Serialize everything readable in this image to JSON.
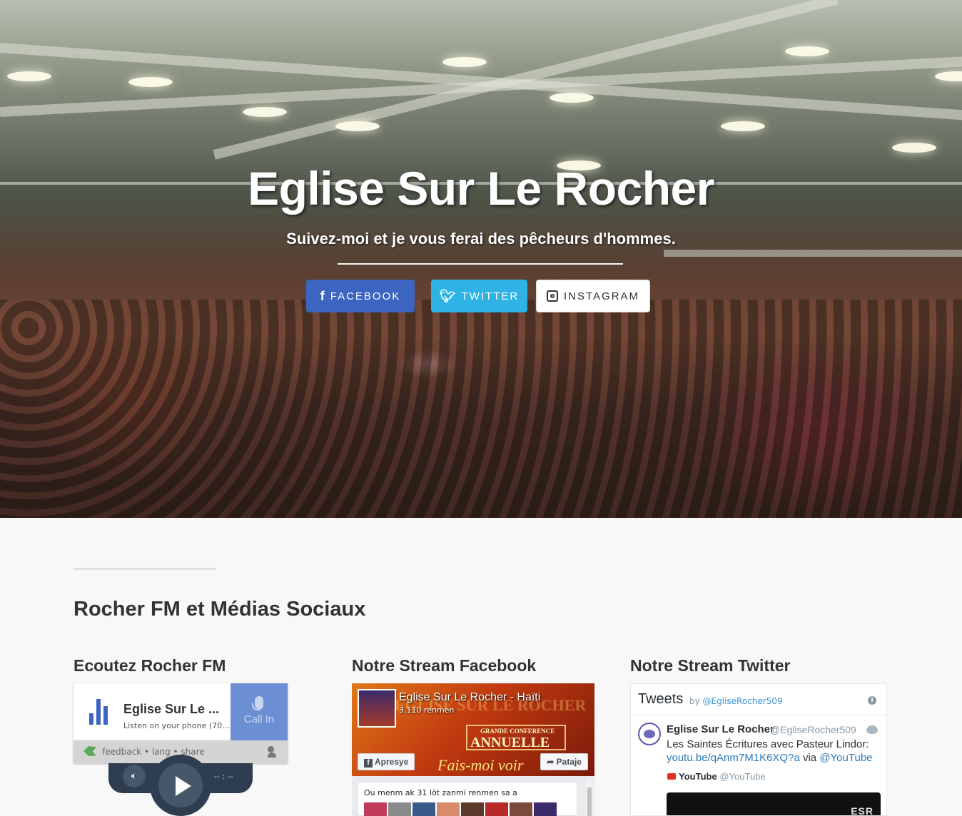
{
  "hero": {
    "title": "Eglise Sur Le Rocher",
    "subtitle": "Suivez-moi et je vous ferai des pêcheurs d'hommes.",
    "buttons": {
      "facebook": "FACEBOOK",
      "twitter": "TWITTER",
      "instagram": "INSTAGRAM"
    }
  },
  "section": {
    "title": "Rocher FM et Médias Sociaux",
    "col_fm": "Ecoutez Rocher FM",
    "col_fb": "Notre Stream Facebook",
    "col_tw": "Notre Stream Twitter"
  },
  "fm": {
    "station_name": "Eglise Sur Le ...",
    "description": "Listen on your phone (70…",
    "call_in": "Call In",
    "footer_links": "feedback • lang • share",
    "time": "-- : --"
  },
  "facebook": {
    "page_name": "Eglise Sur Le Rocher - Haïti",
    "likes": "3,110 renmen",
    "like_button": "Apresye",
    "share_button": "Pataje",
    "cover_small": "GRANDE CONFERENCE",
    "cover_big": "ANNUELLE",
    "cover_script": "Fais-moi voir",
    "cover_header": "EGLISE SUR LE ROCHER",
    "post_text": "Ou menm ak 31 lòt zanmi renmen sa a"
  },
  "twitter": {
    "header_title": "Tweets",
    "by_label": "by",
    "by_handle": "@EgliseRocher509",
    "tweet_author": "Eglise Sur Le Rocher",
    "tweet_handle": "@EgliseRocher509",
    "tweet_text": "Les Saintes Écritures avec Pasteur Lindor:",
    "tweet_link": "youtu.be/qAnm7M1K6XQ?a",
    "tweet_via": "via",
    "tweet_mention": "@YouTube",
    "card_source": "YouTube",
    "card_handle": "@YouTube",
    "media_label": "ESR"
  },
  "colors": {
    "facebook_blue": "#3b65c0",
    "twitter_blue": "#2eb3e4",
    "fm_call": "#6c8fd4",
    "player": "#2e3d4f"
  }
}
